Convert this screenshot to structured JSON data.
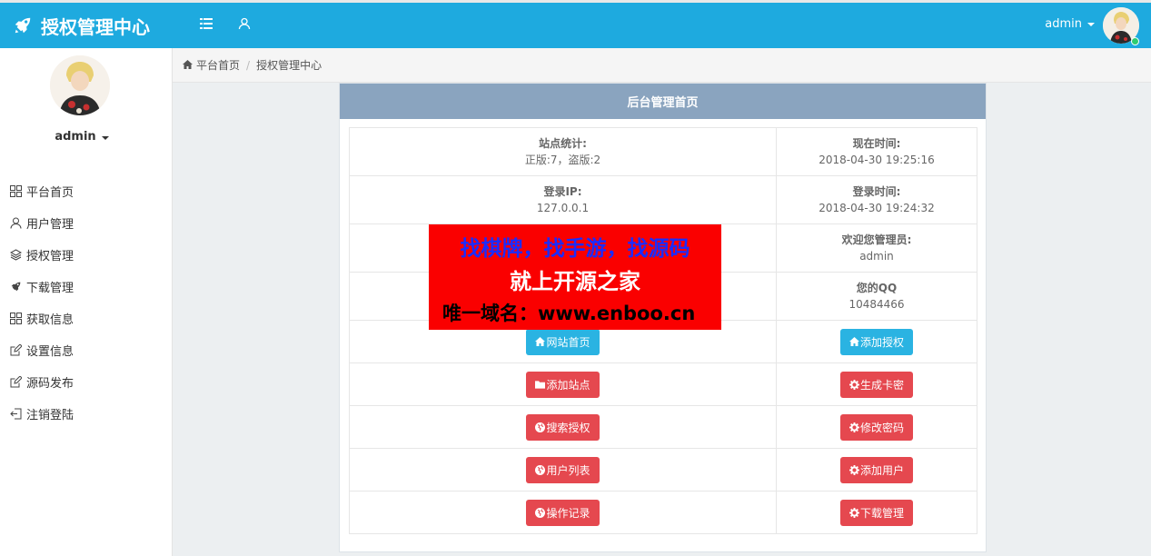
{
  "app": {
    "title": "授权管理中心"
  },
  "header": {
    "user": "admin"
  },
  "sidebar": {
    "user": "admin",
    "items": [
      {
        "label": "平台首页",
        "icon": "grid-icon"
      },
      {
        "label": "用户管理",
        "icon": "user-icon"
      },
      {
        "label": "授权管理",
        "icon": "layers-icon"
      },
      {
        "label": "下载管理",
        "icon": "rocket-icon"
      },
      {
        "label": "获取信息",
        "icon": "grid-icon"
      },
      {
        "label": "设置信息",
        "icon": "edit-icon"
      },
      {
        "label": "源码发布",
        "icon": "edit-icon"
      },
      {
        "label": "注销登陆",
        "icon": "logout-icon"
      }
    ]
  },
  "breadcrumb": {
    "home": "平台首页",
    "current": "授权管理中心"
  },
  "panel": {
    "title": "后台管理首页",
    "info": {
      "stats_label": "站点统计:",
      "stats_value": "正版:7，盗版:2",
      "time_label": "现在时间:",
      "time_value": "2018-04-30 19:25:16",
      "ip_label": "登录IP:",
      "ip_value": "127.0.0.1",
      "login_time_label": "登录时间:",
      "login_time_value": "2018-04-30 19:24:32",
      "welcome_label": "欢迎您管理员:",
      "welcome_value": "admin",
      "qq_label": "您的QQ",
      "qq_value": "10484466"
    },
    "buttons": {
      "site_home": "网站首页",
      "add_auth": "添加授权",
      "add_site": "添加站点",
      "gen_card": "生成卡密",
      "search_auth": "搜索授权",
      "change_pwd": "修改密码",
      "user_list": "用户列表",
      "add_user": "添加用户",
      "op_log": "操作记录",
      "download_mgmt": "下载管理"
    }
  },
  "promo": {
    "line1": "找棋牌，找手游，找源码",
    "line2": "就上开源之家",
    "line3": "唯一域名：www.enboo.cn"
  },
  "colors": {
    "header": "#1eaadf",
    "panel_head": "#8aa4bf",
    "btn_info": "#2ab3e2",
    "btn_danger": "#e5484f",
    "promo_bg": "#fa0000",
    "promo_line1": "#1a2cff"
  }
}
